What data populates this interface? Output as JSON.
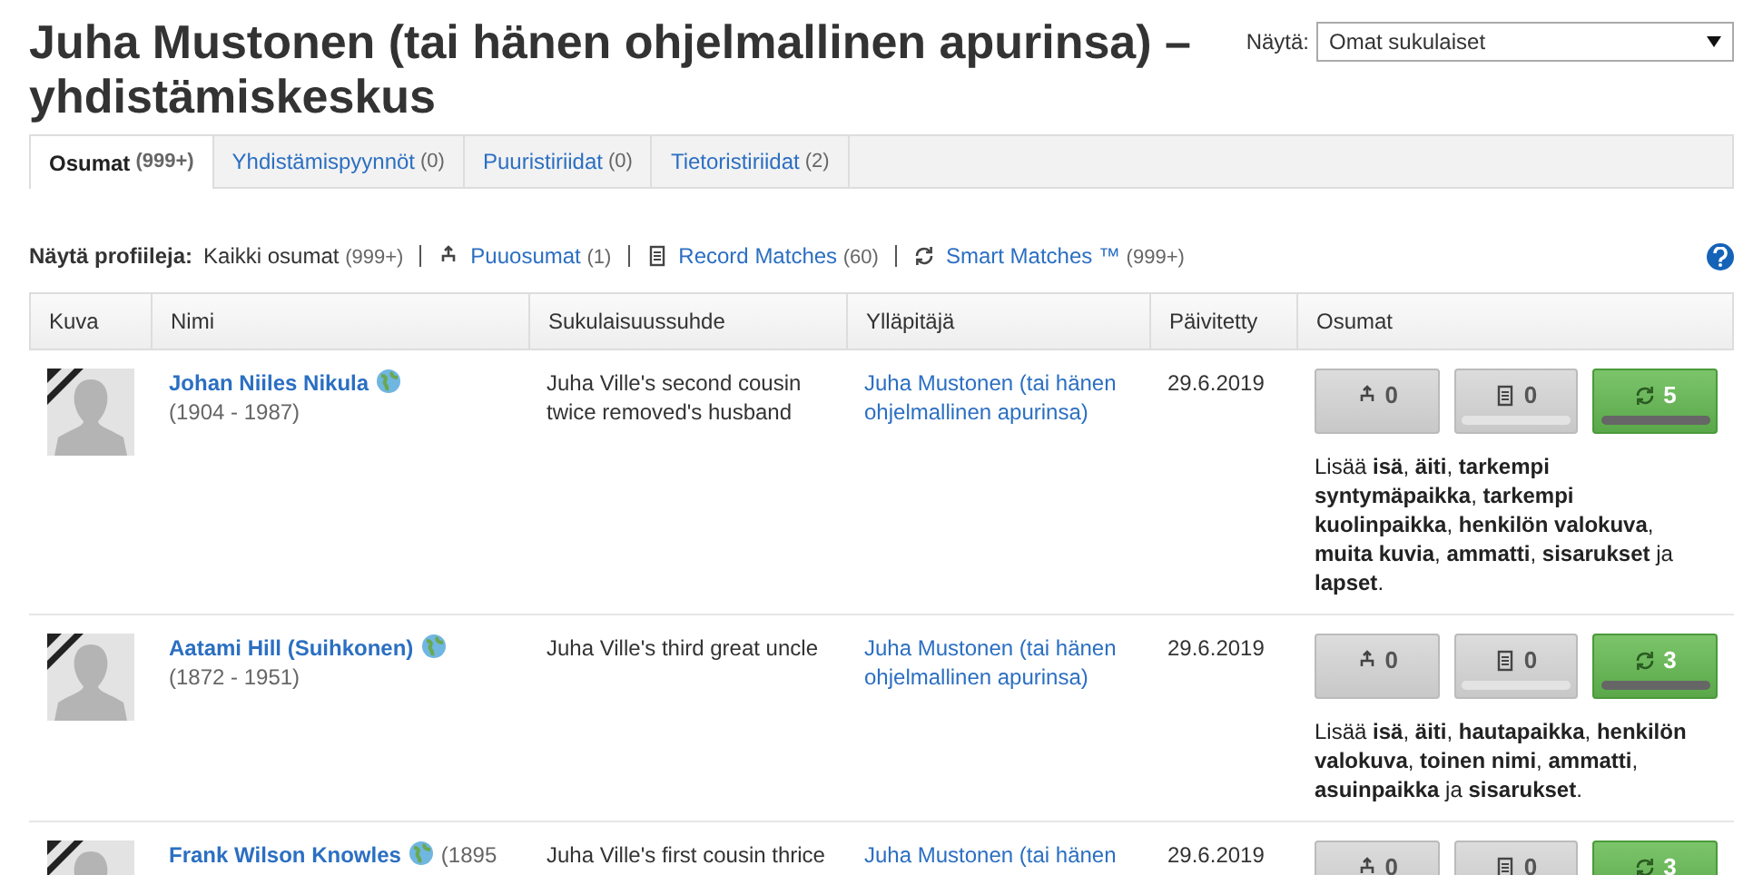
{
  "title": "Juha Mustonen (tai hänen ohjelmallinen apurinsa) – yhdistämiskeskus",
  "view": {
    "label": "Näytä:",
    "value": "Omat sukulaiset"
  },
  "tabs": [
    {
      "label": "Osumat",
      "count": "(999+)",
      "selected": true
    },
    {
      "label": "Yhdistämispyynnöt",
      "count": "(0)",
      "selected": false
    },
    {
      "label": "Puuristiriidat",
      "count": "(0)",
      "selected": false
    },
    {
      "label": "Tietoristiriidat",
      "count": "(2)",
      "selected": false
    }
  ],
  "filter": {
    "label": "Näytä profiileja:",
    "items": [
      {
        "kind": "all",
        "label": "Kaikki osumat",
        "count": "(999+)",
        "selected": true
      },
      {
        "kind": "tree",
        "label": "Puuosumat",
        "count": "(1)",
        "selected": false
      },
      {
        "kind": "record",
        "label": "Record Matches",
        "count": "(60)",
        "selected": false
      },
      {
        "kind": "smart",
        "label": "Smart Matches ™",
        "count": "(999+)",
        "selected": false
      }
    ]
  },
  "table": {
    "columns": [
      "Kuva",
      "Nimi",
      "Sukulaisuussuhde",
      "Ylläpitäjä",
      "Päivitetty",
      "Osumat"
    ],
    "rows": [
      {
        "name": "Johan Niiles Nikula",
        "dates": "(1904 - 1987)",
        "relation": "Juha Ville's second cousin twice removed's husband",
        "manager": "Juha Mustonen (tai hänen ohjelmallinen apurinsa)",
        "updated": "29.6.2019",
        "matches": [
          {
            "kind": "tree",
            "count": "0"
          },
          {
            "kind": "record",
            "count": "0",
            "level": 0
          },
          {
            "kind": "smart",
            "count": "5",
            "level": 1
          }
        ],
        "note": "Lisää **isä**, **äiti**, **tarkempi syntymäpaikka**, **tarkempi kuolinpaikka**, **henkilön valokuva**, **muita kuvia**, **ammatti**, **sisarukset** ja **lapset**."
      },
      {
        "name": "Aatami Hill (Suihkonen)",
        "dates": "(1872 - 1951)",
        "relation": "Juha Ville's third great uncle",
        "manager": "Juha Mustonen (tai hänen ohjelmallinen apurinsa)",
        "updated": "29.6.2019",
        "matches": [
          {
            "kind": "tree",
            "count": "0"
          },
          {
            "kind": "record",
            "count": "0",
            "level": 0
          },
          {
            "kind": "smart",
            "count": "3",
            "level": 1
          }
        ],
        "note": "Lisää **isä**, **äiti**, **hautapaikka**, **henkilön valokuva**, **toinen nimi**, **ammatti**, **asuinpaikka** ja **sisarukset**."
      },
      {
        "name": "Frank Wilson Knowles",
        "dates": "(1895",
        "relation": "Juha Ville's first cousin thrice",
        "manager": "Juha Mustonen (tai hänen",
        "updated": "29.6.2019",
        "matches": [
          {
            "kind": "tree",
            "count": "0"
          },
          {
            "kind": "record",
            "count": "0"
          },
          {
            "kind": "smart",
            "count": "3"
          }
        ]
      }
    ]
  }
}
